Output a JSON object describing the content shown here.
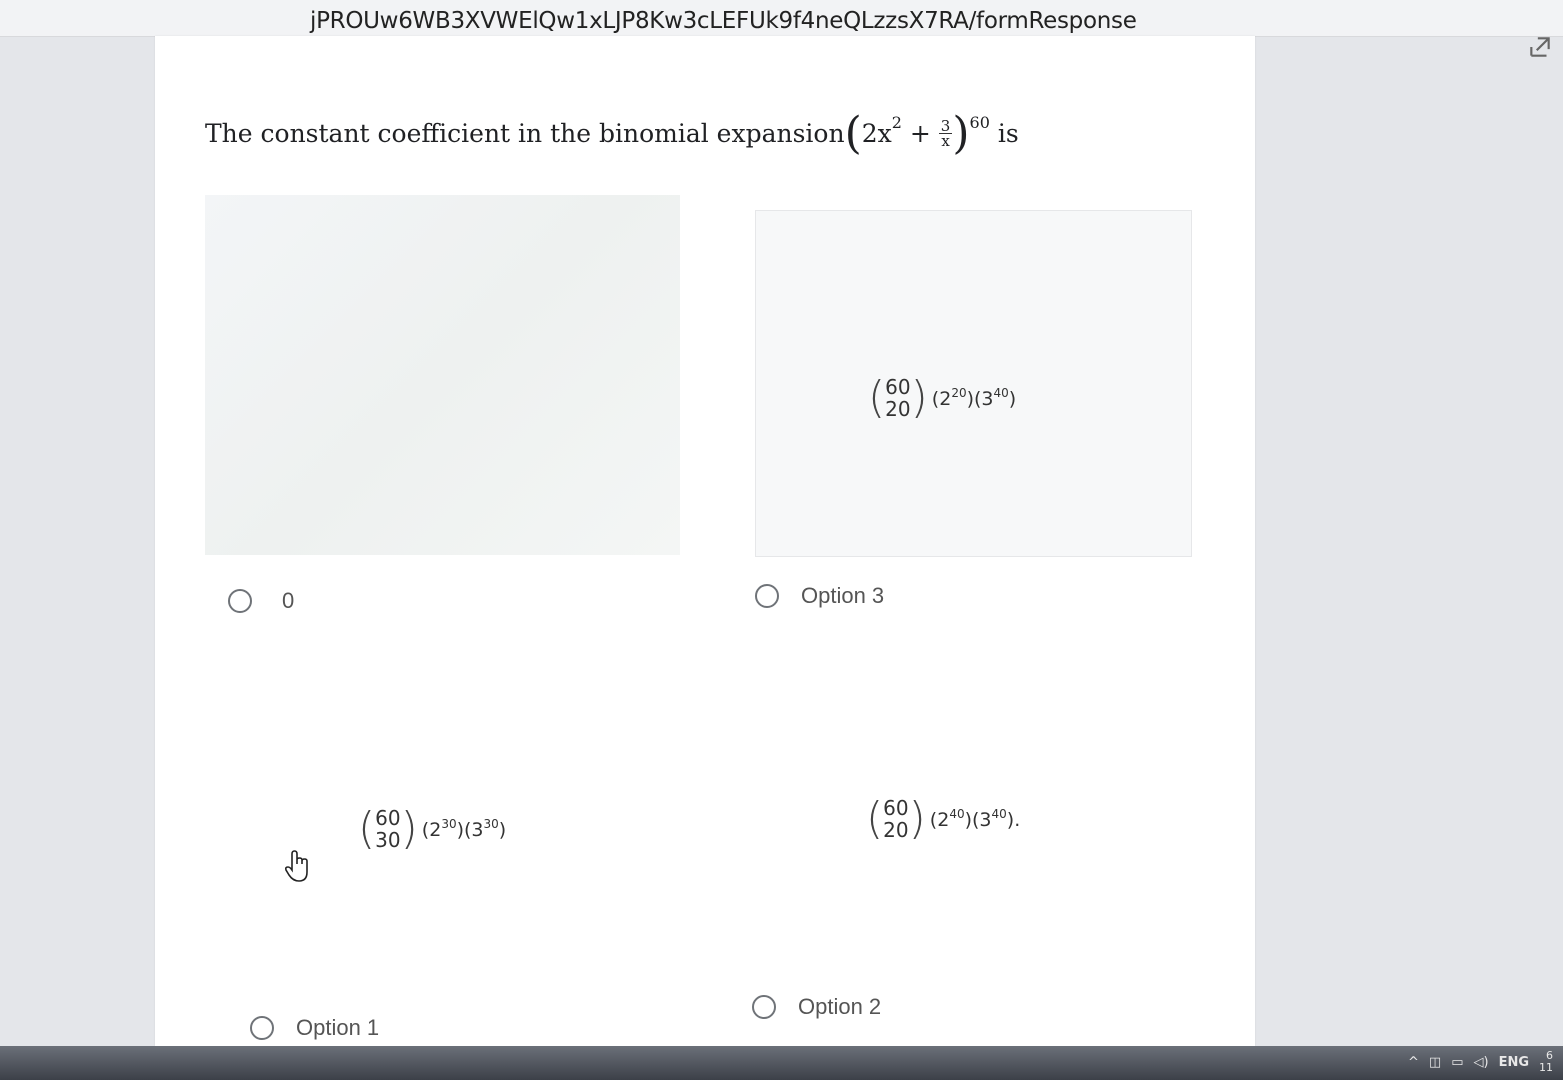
{
  "browser": {
    "url": "jPROUw6WB3XVWElQw1xLJP8Kw3cLEFUk9f4neQLzzsX7RA/formResponse"
  },
  "question": {
    "prefix": "The constant coefficient in the binomial expansion",
    "expr_base": "2x",
    "expr_base_exp": "2",
    "plus": "+",
    "frac_num": "3",
    "frac_den": "x",
    "outer_exp": "60",
    "suffix": "is"
  },
  "images": {
    "right_top": {
      "n": "60",
      "k": "20",
      "p1_base": "2",
      "p1_exp": "20",
      "p2_base": "3",
      "p2_exp": "40",
      "tail": ""
    },
    "left_bottom": {
      "n": "60",
      "k": "30",
      "p1_base": "2",
      "p1_exp": "30",
      "p2_base": "3",
      "p2_exp": "30",
      "tail": ""
    },
    "right_bottom": {
      "n": "60",
      "k": "20",
      "p1_base": "2",
      "p1_exp": "40",
      "p2_base": "3",
      "p2_exp": "40",
      "tail": "."
    }
  },
  "options": {
    "opt_a": "0",
    "opt_b": "Option 3",
    "opt_c": "Option 1",
    "opt_d": "Option 2"
  },
  "taskbar": {
    "lang": "ENG",
    "clock_line1": "6",
    "clock_line2": "11"
  },
  "icons": [
    "share-icon",
    "hand-cursor-icon",
    "chevron-up-icon",
    "network-icon",
    "battery-icon",
    "volume-icon"
  ]
}
